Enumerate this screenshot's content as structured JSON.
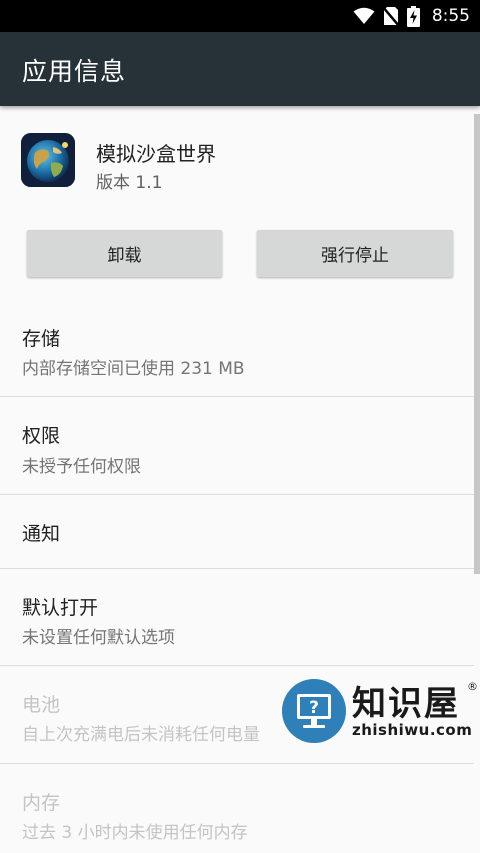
{
  "status_bar": {
    "time": "8:55",
    "icons": [
      "wifi-icon",
      "no-sim-icon",
      "battery-charging-icon"
    ]
  },
  "app_bar": {
    "title": "应用信息"
  },
  "app": {
    "name": "模拟沙盒世界",
    "version": "版本 1.1",
    "icon": "globe-app-icon"
  },
  "buttons": {
    "uninstall": "卸载",
    "force_stop": "强行停止"
  },
  "settings": [
    {
      "title": "存储",
      "summary": "内部存储空间已使用 231 MB",
      "enabled": true
    },
    {
      "title": "权限",
      "summary": "未授予任何权限",
      "enabled": true
    },
    {
      "title": "通知",
      "summary": "",
      "enabled": true
    },
    {
      "title": "默认打开",
      "summary": "未设置任何默认选项",
      "enabled": true
    },
    {
      "title": "电池",
      "summary": "自上次充满电后未消耗任何电量",
      "enabled": false
    },
    {
      "title": "内存",
      "summary": "过去 3 小时内未使用任何内存",
      "enabled": false
    }
  ],
  "watermark": {
    "name": "知识屋",
    "registered": "®",
    "url": "zhishiwu.com"
  },
  "colors": {
    "app_bar": "#263238",
    "status_bar": "#000000",
    "background": "#fafafa",
    "button": "#d6d7d7",
    "watermark_badge": "#2f7fb8"
  }
}
